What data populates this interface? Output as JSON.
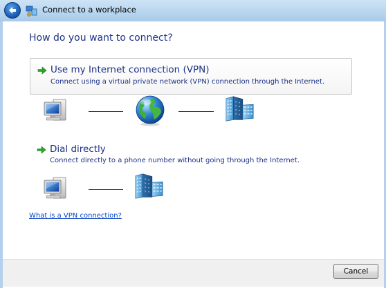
{
  "window": {
    "title": "Connect to a workplace"
  },
  "main": {
    "heading": "How do you want to connect?",
    "options": [
      {
        "title": "Use my Internet connection (VPN)",
        "description": "Connect using a virtual private network (VPN) connection through the Internet."
      },
      {
        "title": "Dial directly",
        "description": "Connect directly to a phone number without going through the Internet."
      }
    ],
    "help_link": "What is a VPN connection?"
  },
  "footer": {
    "cancel_label": "Cancel"
  },
  "icons": {
    "back": "back-arrow-icon",
    "title": "network-workplace-icon",
    "option_arrow": "green-arrow-icon",
    "computer": "computer-icon",
    "globe": "internet-globe-icon",
    "workplace": "office-building-icon"
  },
  "colors": {
    "heading": "#1e3287",
    "link": "#0b47c4",
    "option_arrow": "#2aa52a",
    "frame": "#b9d6f0"
  }
}
